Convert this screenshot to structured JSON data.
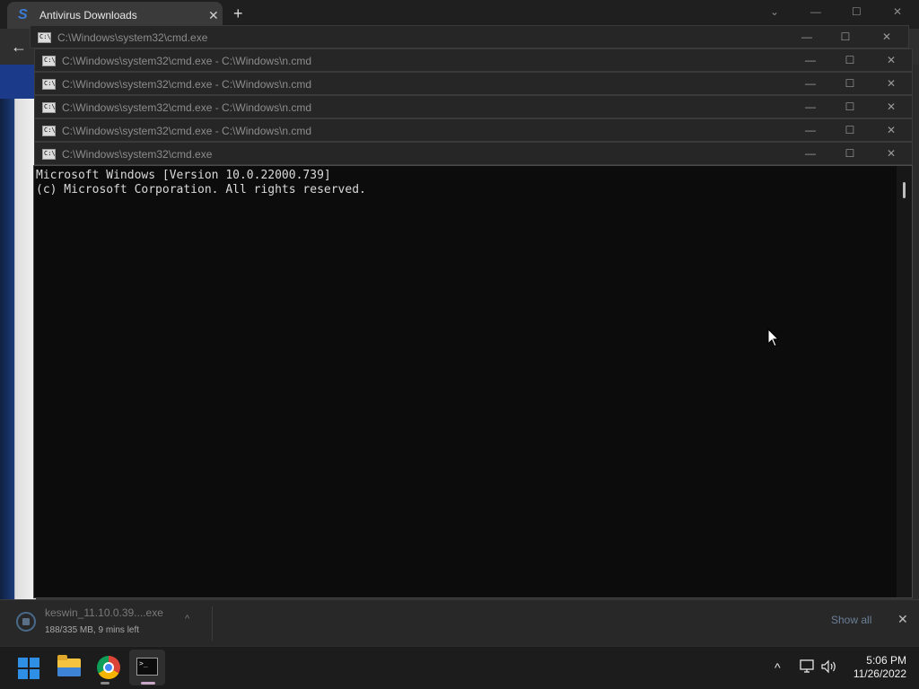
{
  "browser": {
    "tab_title": "Antivirus Downloads",
    "tab_logo": "S",
    "new_tab": "+",
    "close": "✕",
    "back": "←"
  },
  "download": {
    "file_name": "keswin_11.10.0.39....exe",
    "status": "188/335 MB, 9 mins left",
    "show_all": "Show all",
    "close": "✕",
    "chevron": "^"
  },
  "cmd_windows": [
    {
      "title": "C:\\Windows\\system32\\cmd.exe"
    },
    {
      "title": "C:\\Windows\\system32\\cmd.exe - C:\\Windows\\n.cmd"
    },
    {
      "title": "C:\\Windows\\system32\\cmd.exe - C:\\Windows\\n.cmd"
    },
    {
      "title": "C:\\Windows\\system32\\cmd.exe - C:\\Windows\\n.cmd"
    },
    {
      "title": "C:\\Windows\\system32\\cmd.exe - C:\\Windows\\n.cmd"
    },
    {
      "title": "C:\\Windows\\system32\\cmd.exe"
    }
  ],
  "window_controls": {
    "minimize": "—",
    "maximize": "☐",
    "close": "✕"
  },
  "console": {
    "line1": "Microsoft Windows [Version 10.0.22000.739]",
    "line2": "(c) Microsoft Corporation. All rights reserved."
  },
  "taskbar": {
    "time": "5:06 PM",
    "date": "11/26/2022",
    "tray_chevron": "^",
    "network_icon": "network-icon",
    "volume_icon": "volume-icon"
  }
}
